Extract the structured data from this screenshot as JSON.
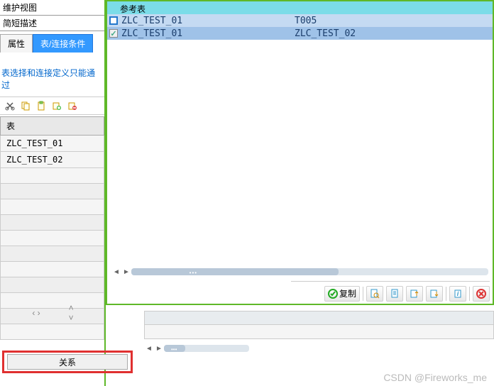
{
  "left": {
    "maint_view_label": "维护视图",
    "short_desc_label": "简短描述",
    "tabs": {
      "attr": "属性",
      "tablejoin": "表/连接条件"
    },
    "info_text": "表选择和连接定义只能通过",
    "table_header": "表",
    "table_rows": [
      "ZLC_TEST_01",
      "ZLC_TEST_02"
    ],
    "relation_btn": "关系"
  },
  "dialog": {
    "ref_header": "参考表",
    "rows": [
      {
        "checked": false,
        "col1": "ZLC_TEST_01",
        "col2": "T005"
      },
      {
        "checked": true,
        "col1": "ZLC_TEST_01",
        "col2": "ZLC_TEST_02"
      }
    ],
    "copy_btn": "复制"
  },
  "watermark": "CSDN @Fireworks_me"
}
